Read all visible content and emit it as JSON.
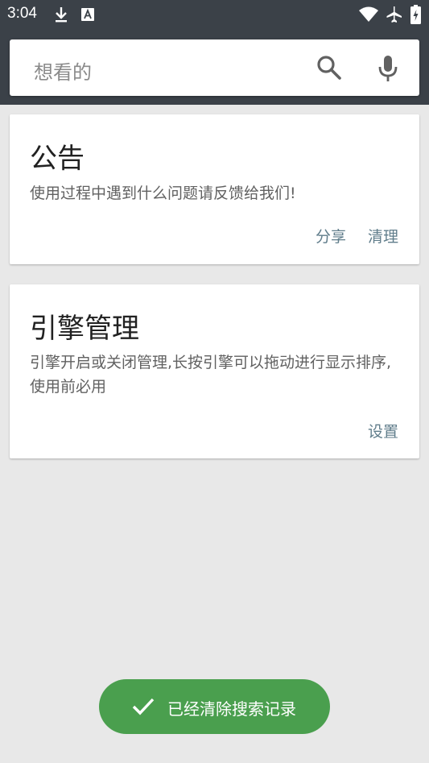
{
  "status_bar": {
    "time": "3:04",
    "icons": [
      "download-icon",
      "a-notification-icon",
      "wifi-icon",
      "airplane-mode-icon",
      "battery-charging-icon"
    ]
  },
  "search": {
    "placeholder": "想看的",
    "search_icon": "search-icon",
    "mic_icon": "microphone-icon"
  },
  "cards": [
    {
      "title": "公告",
      "body": "使用过程中遇到什么问题请反馈给我们!",
      "actions": [
        "分享",
        "清理"
      ]
    },
    {
      "title": "引擎管理",
      "body": "引擎开启或关闭管理,长按引擎可以拖动进行显示排序,使用前必用",
      "actions": [
        "设置"
      ]
    }
  ],
  "toast": {
    "icon": "check-icon",
    "text": "已经清除搜索记录"
  },
  "colors": {
    "header": "#3b4148",
    "background": "#e8e8e8",
    "action_text": "#607d8b",
    "toast": "#4a9f4e"
  }
}
